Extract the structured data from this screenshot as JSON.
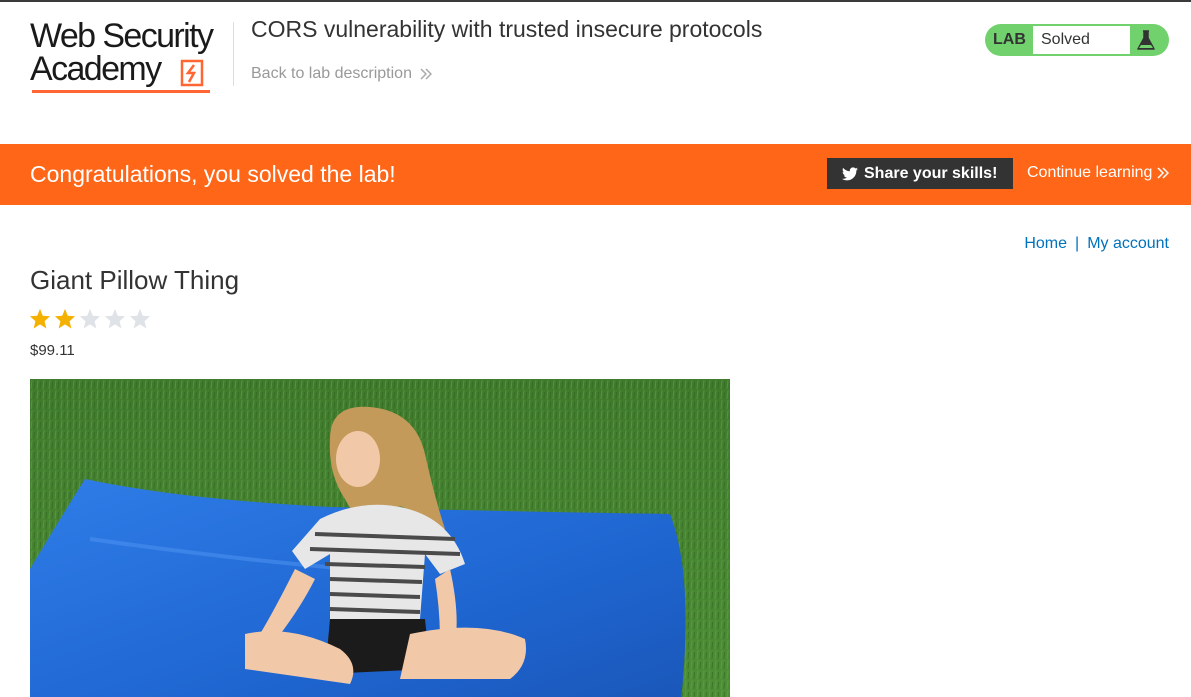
{
  "colors": {
    "brand_orange": "#ff6618",
    "lab_solved_green": "#70d16d",
    "link_blue": "#0071bc",
    "dark": "#333333"
  },
  "header": {
    "logo": {
      "line1": "Web Security",
      "line2": "Academy",
      "icon": "academy-logo-icon"
    },
    "lab_title": "CORS vulnerability with trusted insecure protocols",
    "back_link": "Back to lab description",
    "back_icon": "double-chevron-right-icon",
    "lab_badge": {
      "label": "LAB",
      "status": "Solved",
      "icon": "flask-icon"
    }
  },
  "banner": {
    "message": "Congratulations, you solved the lab!",
    "share_button": "Share your skills!",
    "share_icon": "twitter-icon",
    "continue_link": "Continue learning",
    "continue_icon": "double-chevron-right-icon"
  },
  "nav": {
    "home": "Home",
    "separator": "|",
    "my_account": "My account"
  },
  "product": {
    "name": "Giant Pillow Thing",
    "rating": 2,
    "rating_max": 5,
    "price": "$99.11",
    "image": "product-photo-child-on-blue-pillow"
  }
}
